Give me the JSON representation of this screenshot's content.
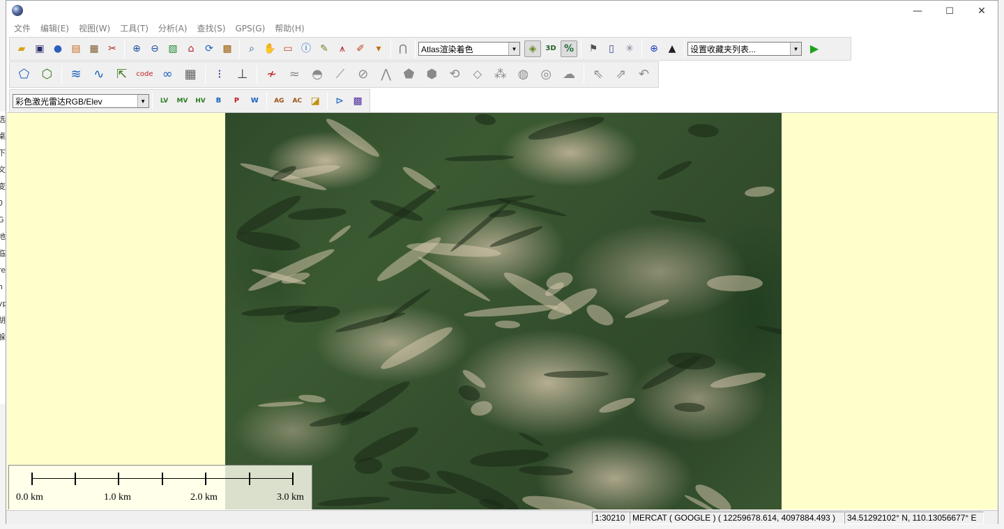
{
  "window": {
    "minimize_glyph": "—",
    "maximize_glyph": "☐",
    "close_glyph": "✕"
  },
  "menu": [
    "文件",
    "编辑(E)",
    "视图(W)",
    "工具(T)",
    "分析(A)",
    "查找(S)",
    "GPS(G)",
    "帮助(H)"
  ],
  "toolbar1": {
    "render_mode": "Atlas渲染着色",
    "favorites": "设置收藏夹列表..."
  },
  "toolbar3": {
    "shader": "彩色激光雷达RGB/Elev",
    "lidar_buttons": [
      "LV",
      "MV",
      "HV",
      "B",
      "P",
      "W",
      "AG",
      "AC"
    ]
  },
  "background_left_text": [
    "选",
    "桌",
    "下",
    "文",
    "变",
    "0",
    "G",
    "地",
    "临",
    "re",
    "n",
    "yp",
    "胡",
    "躲"
  ],
  "scale": {
    "labels": [
      "0.0 km",
      "1.0 km",
      "2.0 km",
      "3.0 km"
    ]
  },
  "status": {
    "scale": "1:30210",
    "projection": "MERCAT ( GOOGLE ) ( 12259678.614, 4097884.493 )",
    "latlon": "34.51292102° N, 110.13056677° E"
  },
  "colors": {
    "map_background": "#ffffcc",
    "toolbar_bg": "#f0f0f0",
    "accent_green": "#1fa31f"
  }
}
